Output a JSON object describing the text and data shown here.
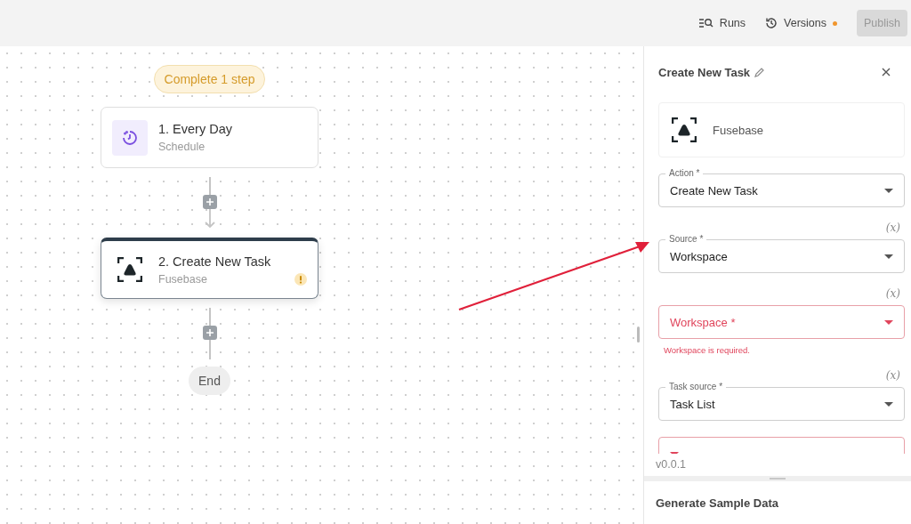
{
  "toolbar": {
    "runs": "Runs",
    "versions": "Versions",
    "versions_unsaved": true,
    "publish": {
      "label": "Publish",
      "disabled": true
    }
  },
  "canvas": {
    "status_badge": "Complete 1 step",
    "steps": [
      {
        "kind": "schedule",
        "title": "1. Every Day",
        "subtitle": "Schedule",
        "selected": false,
        "warning": false,
        "arrow_after": true
      },
      {
        "kind": "fusebase",
        "title": "2. Create New Task",
        "subtitle": "Fusebase",
        "selected": true,
        "warning": true,
        "arrow_after": false
      }
    ],
    "end_label": "End"
  },
  "panel": {
    "title": "Create New Task",
    "app": {
      "kind": "fusebase",
      "name": "Fusebase"
    },
    "fields": [
      {
        "label": "Action *",
        "value": "Create New Task",
        "invalid": false
      },
      {
        "label": "Source *",
        "value": "Workspace",
        "invalid": false,
        "variable_toggle": "(x)"
      },
      {
        "label": "Workspace *",
        "invalid": true,
        "error": "Workspace is required.",
        "variable_toggle": "(x)"
      },
      {
        "label": "Task source *",
        "value": "Task List",
        "invalid": false,
        "variable_toggle": "(x)"
      },
      {
        "invalid": true
      }
    ],
    "version": "v0.0.1",
    "footer_title": "Generate Sample Data"
  }
}
